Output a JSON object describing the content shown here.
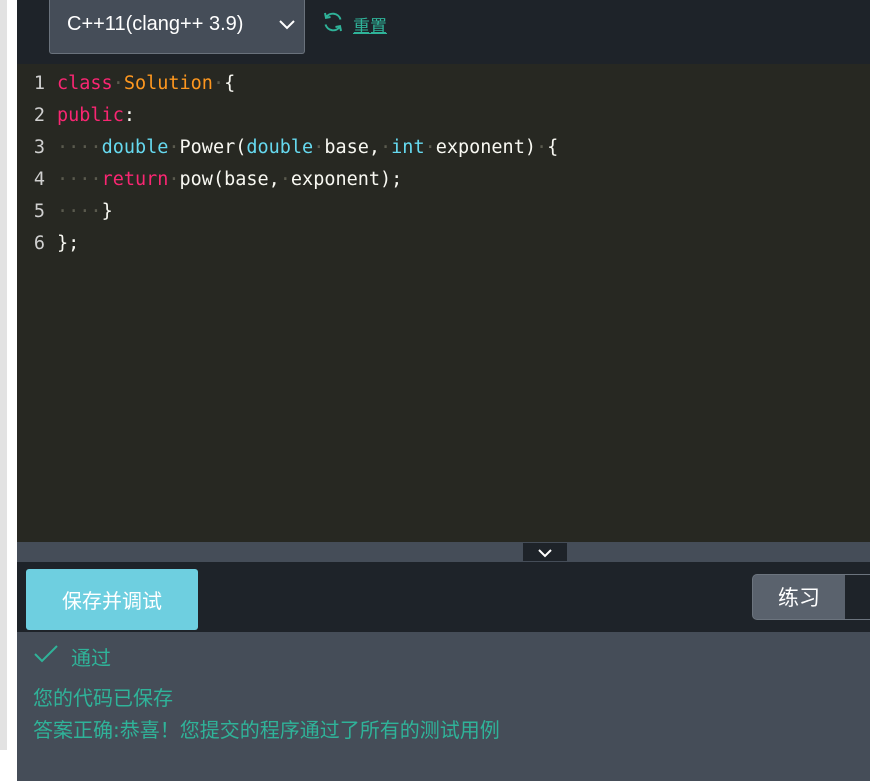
{
  "toolbar": {
    "language": "C++11(clang++ 3.9)",
    "language_icon": "chevron-down-icon",
    "reset_label": "重置",
    "reset_icon": "refresh-icon"
  },
  "editor": {
    "line_numbers": [
      "1",
      "2",
      "3",
      "4",
      "5",
      "6"
    ],
    "lines": [
      [
        {
          "t": "class",
          "c": "kw"
        },
        {
          "t": "·",
          "c": "ws"
        },
        {
          "t": "Solution",
          "c": "cls"
        },
        {
          "t": "·",
          "c": "ws"
        },
        {
          "t": "{",
          "c": ""
        }
      ],
      [
        {
          "t": "public",
          "c": "kw"
        },
        {
          "t": ":",
          "c": ""
        }
      ],
      [
        {
          "t": "····",
          "c": "ws"
        },
        {
          "t": "double",
          "c": "typ"
        },
        {
          "t": "·",
          "c": "ws"
        },
        {
          "t": "Power(",
          "c": ""
        },
        {
          "t": "double",
          "c": "typ"
        },
        {
          "t": "·",
          "c": "ws"
        },
        {
          "t": "base,",
          "c": ""
        },
        {
          "t": "·",
          "c": "ws"
        },
        {
          "t": "int",
          "c": "typ"
        },
        {
          "t": "·",
          "c": "ws"
        },
        {
          "t": "exponent)",
          "c": ""
        },
        {
          "t": "·",
          "c": "ws"
        },
        {
          "t": "{",
          "c": ""
        }
      ],
      [
        {
          "t": "····",
          "c": "ws"
        },
        {
          "t": "return",
          "c": "kw"
        },
        {
          "t": "·",
          "c": "ws"
        },
        {
          "t": "pow(base,",
          "c": ""
        },
        {
          "t": "·",
          "c": "ws"
        },
        {
          "t": "exponent);",
          "c": ""
        }
      ],
      [
        {
          "t": "····",
          "c": "ws"
        },
        {
          "t": "}",
          "c": ""
        }
      ],
      [
        {
          "t": "};",
          "c": ""
        }
      ]
    ]
  },
  "actions": {
    "save_debug_label": "保存并调试",
    "mode_label": "练习"
  },
  "result": {
    "status_label": "通过",
    "status_icon": "check-icon",
    "saved_message": "您的代码已保存",
    "success_message": "答案正确:恭喜！您提交的程序通过了所有的测试用例"
  },
  "colors": {
    "accent": "#2fb399",
    "button": "#6ecfe0",
    "editor_bg": "#272822",
    "keyword": "#f92672",
    "type": "#66d9ef",
    "class_name": "#fd971f"
  }
}
